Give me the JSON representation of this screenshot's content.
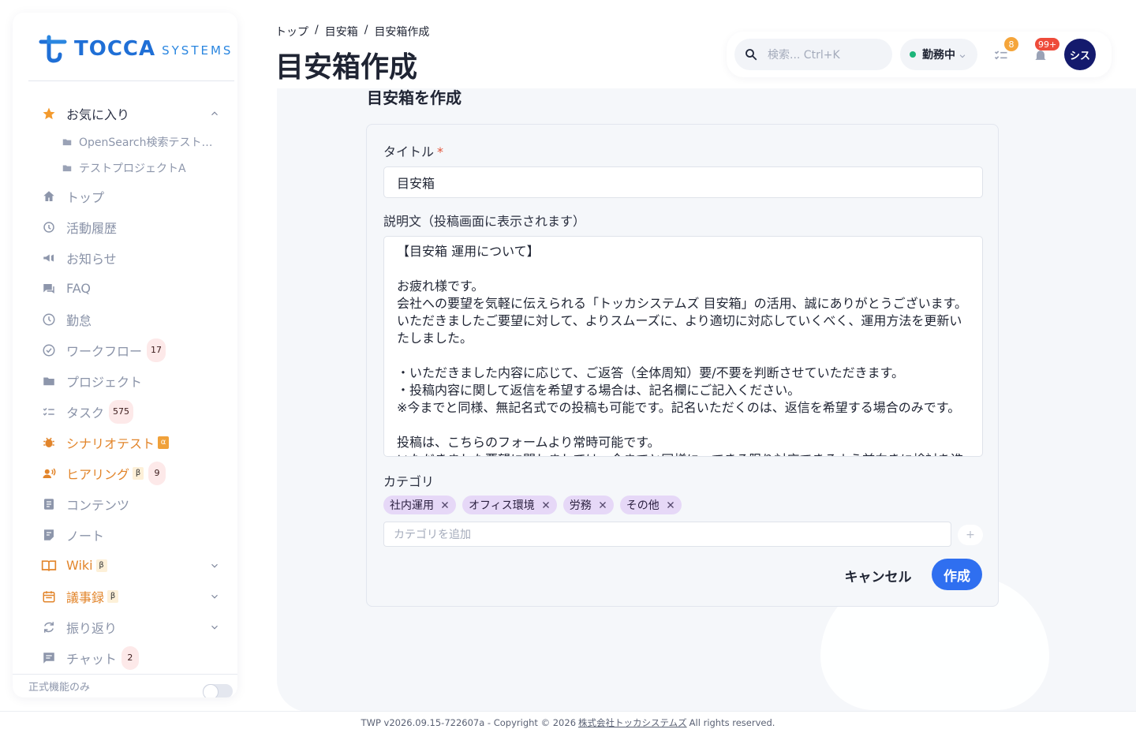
{
  "brand": {
    "name": "TOCCA",
    "sub": "SYSTEMS",
    "color": "#1f6fd6"
  },
  "sidebar": {
    "favorites": {
      "label": "お気に入り",
      "icon": "star-icon"
    },
    "fav_items": [
      {
        "label": "OpenSearch検索テスト用プ...",
        "icon": "folder-icon"
      },
      {
        "label": "テストプロジェクトA",
        "icon": "folder-icon"
      }
    ],
    "items": [
      {
        "label": "トップ",
        "icon": "home-icon"
      },
      {
        "label": "活動履歴",
        "icon": "history-icon"
      },
      {
        "label": "お知らせ",
        "icon": "megaphone-icon"
      },
      {
        "label": "FAQ",
        "icon": "chat-icon"
      },
      {
        "label": "勤怠",
        "icon": "clock-icon"
      },
      {
        "label": "ワークフロー",
        "icon": "check-circle-icon",
        "badge": "17"
      },
      {
        "label": "プロジェクト",
        "icon": "folder-icon"
      },
      {
        "label": "タスク",
        "icon": "tasklist-icon",
        "badge": "575"
      },
      {
        "label": "シナリオテスト",
        "icon": "bug-icon",
        "tag": "α"
      },
      {
        "label": "ヒアリング",
        "icon": "hearing-icon",
        "tag": "β",
        "badge": "9"
      },
      {
        "label": "コンテンツ",
        "icon": "document-icon"
      },
      {
        "label": "ノート",
        "icon": "note-icon"
      },
      {
        "label": "Wiki",
        "icon": "book-icon",
        "tag": "β"
      },
      {
        "label": "議事録",
        "icon": "calendar-icon",
        "tag": "β"
      },
      {
        "label": "振り返り",
        "icon": "refresh-icon"
      },
      {
        "label": "チャット",
        "icon": "chat-bubble-icon",
        "badge": "2"
      }
    ],
    "footer_label": "正式機能のみ"
  },
  "header": {
    "breadcrumb": [
      "トップ",
      "/",
      "目安箱",
      "/",
      "目安箱作成"
    ],
    "title": "目安箱作成",
    "search_placeholder": "検索... Ctrl+K",
    "status_label": "勤務中",
    "status_color": "#1db57a",
    "task_count": "8",
    "notif_count": "99+",
    "avatar": "シス"
  },
  "form": {
    "section_title": "目安箱を作成",
    "title_label": "タイトル",
    "required_mark": "*",
    "title_value": "目安箱",
    "desc_label": "説明文（投稿画面に表示されます）",
    "desc_value": "【目安箱 運用について】\n\nお疲れ様です。\n会社への要望を気軽に伝えられる「トッカシステムズ 目安箱」の活用、誠にありがとうございます。\nいただきましたご要望に対して、よりスムーズに、より適切に対応していくべく、運用方法を更新いたしました。\n\n・いただきました内容に応じて、ご返答（全体周知）要/不要を判断させていただきます。\n・投稿内容に関して返信を希望する場合は、記名欄にご記入ください。\n※今までと同様、無記名式での投稿も可能です。記名いただくのは、返信を希望する場合のみです。\n\n投稿は、こちらのフォームより常時可能です。\nいただきました要望に関しましては、今までと同様に、できる限り対応できるよう前向きに検討を進",
    "category_label": "カテゴリ",
    "tags": [
      "社内運用",
      "オフィス環境",
      "労務",
      "その他"
    ],
    "category_placeholder": "カテゴリを追加",
    "add_label": "+",
    "cancel_label": "キャンセル",
    "create_label": "作成"
  },
  "footer": {
    "prefix": "TWP v2026.09.15-722607a - Copyright © 2026",
    "company": "株式会社トッカシステムズ",
    "suffix": "All rights reserved."
  }
}
